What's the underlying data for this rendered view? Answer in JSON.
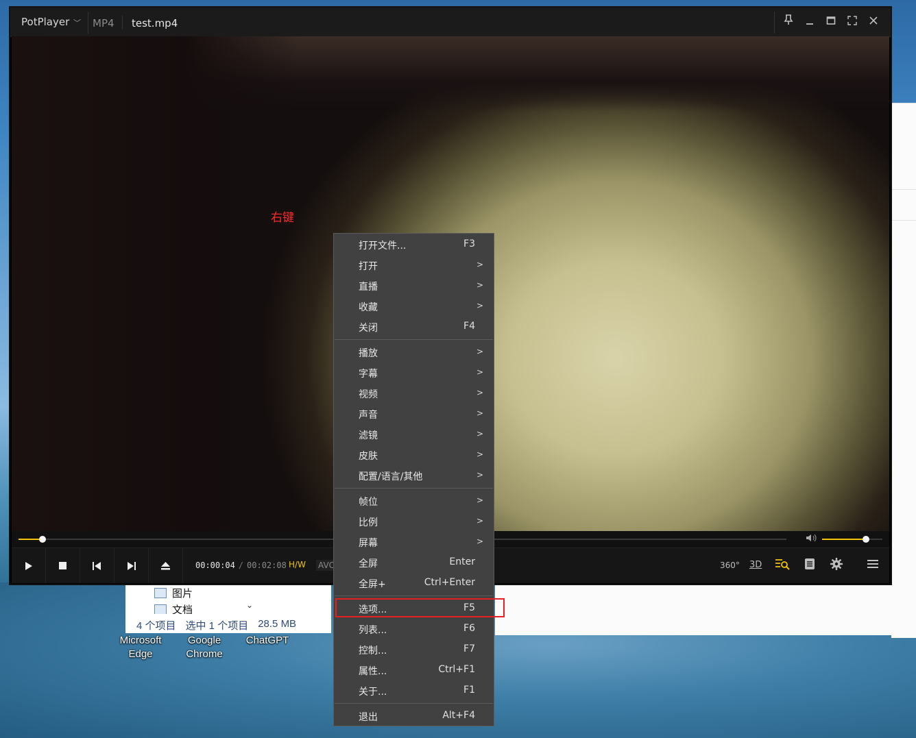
{
  "desktop": {
    "explorer": {
      "items": [
        {
          "label": "图片"
        },
        {
          "label": "文档"
        }
      ],
      "status": {
        "count": "4 个项目",
        "selected": "选中 1 个项目",
        "size": "28.5 MB"
      }
    },
    "icons": [
      {
        "label": "Microsoft Edge",
        "line1": "Microsoft",
        "line2": "Edge"
      },
      {
        "label": "Google Chrome",
        "line1": "Google",
        "line2": "Chrome"
      },
      {
        "label": "ChatGPT",
        "line1": "ChatGPT",
        "line2": ""
      }
    ]
  },
  "player": {
    "app_name": "PotPlayer",
    "format": "MP4",
    "file_name": "test.mp4",
    "time_current": "00:00:04",
    "time_total": "00:02:08",
    "hw_label": "H/W",
    "codec_label": "AVC",
    "progress_fraction": 0.031,
    "volume_fraction": 0.73,
    "right_controls": {
      "vr": "360°",
      "three_d": "3D"
    }
  },
  "annotation": {
    "text": "右键",
    "color": "#ff2a2a"
  },
  "colors": {
    "accent": "#f2c500",
    "highlight_box": "#e62020",
    "menu_bg": "#414141"
  },
  "context_menu": {
    "items": [
      {
        "label": "打开文件...",
        "shortcut": "F3"
      },
      {
        "label": "打开",
        "shortcut": ">"
      },
      {
        "label": "直播",
        "shortcut": ">"
      },
      {
        "label": "收藏",
        "shortcut": ">"
      },
      {
        "label": "关闭",
        "shortcut": "F4"
      },
      {
        "label": "播放",
        "shortcut": ">"
      },
      {
        "label": "字幕",
        "shortcut": ">"
      },
      {
        "label": "视频",
        "shortcut": ">"
      },
      {
        "label": "声音",
        "shortcut": ">"
      },
      {
        "label": "滤镜",
        "shortcut": ">"
      },
      {
        "label": "皮肤",
        "shortcut": ">"
      },
      {
        "label": "配置/语言/其他",
        "shortcut": ">"
      },
      {
        "label": "帧位",
        "shortcut": ">"
      },
      {
        "label": "比例",
        "shortcut": ">"
      },
      {
        "label": "屏幕",
        "shortcut": ">"
      },
      {
        "label": "全屏",
        "shortcut": "Enter"
      },
      {
        "label": "全屏+",
        "shortcut": "Ctrl+Enter"
      },
      {
        "label": "选项...",
        "shortcut": "F5",
        "highlighted": true
      },
      {
        "label": "列表...",
        "shortcut": "F6"
      },
      {
        "label": "控制...",
        "shortcut": "F7"
      },
      {
        "label": "属性...",
        "shortcut": "Ctrl+F1"
      },
      {
        "label": "关于...",
        "shortcut": "F1"
      },
      {
        "label": "退出",
        "shortcut": "Alt+F4"
      }
    ]
  }
}
